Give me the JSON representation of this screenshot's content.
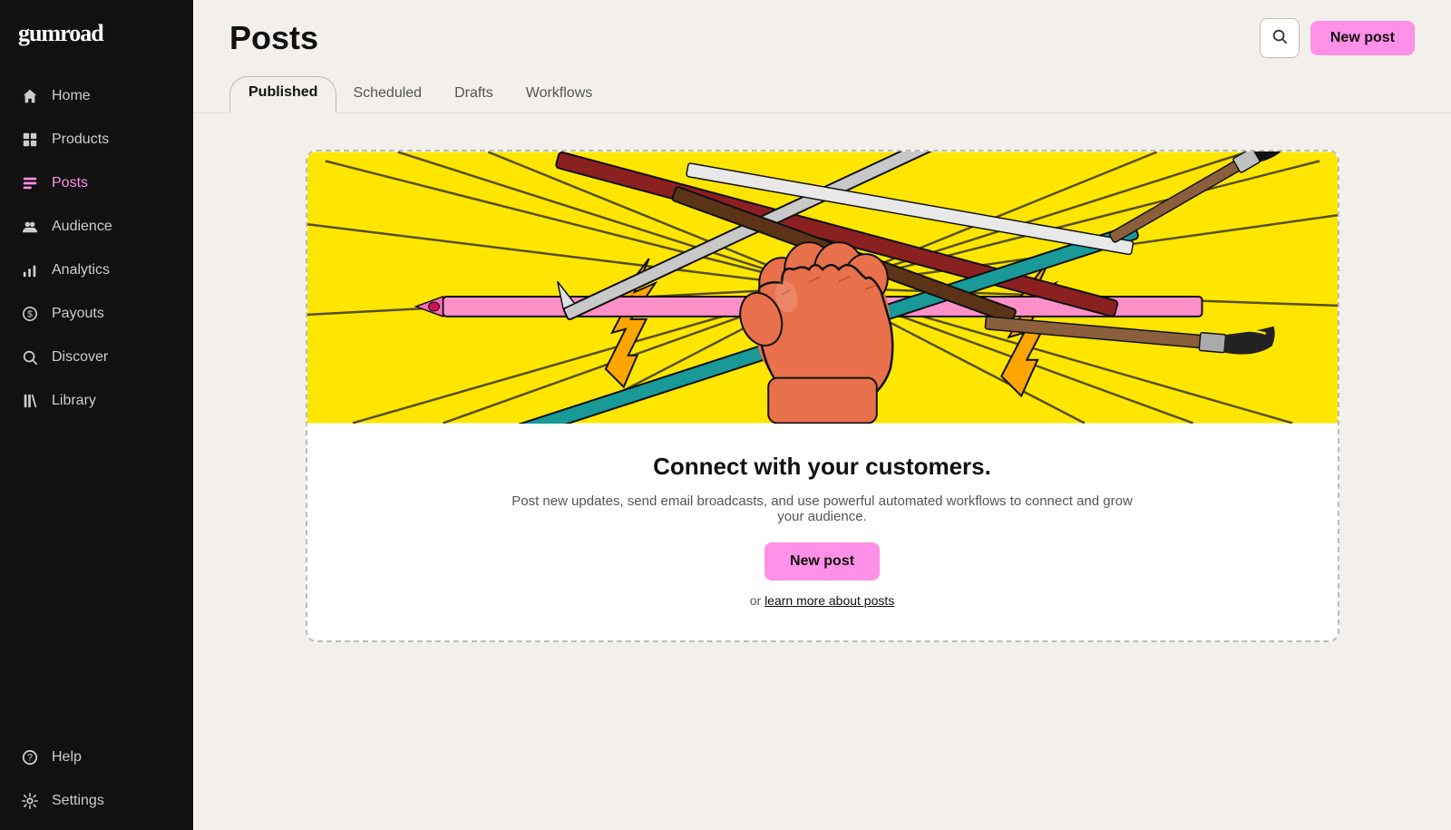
{
  "sidebar": {
    "logo": "gumroad",
    "items": [
      {
        "id": "home",
        "label": "Home",
        "icon": "home-icon"
      },
      {
        "id": "products",
        "label": "Products",
        "icon": "products-icon"
      },
      {
        "id": "posts",
        "label": "Posts",
        "icon": "posts-icon",
        "active": true
      },
      {
        "id": "audience",
        "label": "Audience",
        "icon": "audience-icon"
      },
      {
        "id": "analytics",
        "label": "Analytics",
        "icon": "analytics-icon"
      },
      {
        "id": "payouts",
        "label": "Payouts",
        "icon": "payouts-icon"
      },
      {
        "id": "discover",
        "label": "Discover",
        "icon": "discover-icon"
      },
      {
        "id": "library",
        "label": "Library",
        "icon": "library-icon"
      }
    ],
    "bottom_items": [
      {
        "id": "help",
        "label": "Help",
        "icon": "help-icon"
      },
      {
        "id": "settings",
        "label": "Settings",
        "icon": "settings-icon"
      }
    ]
  },
  "header": {
    "title": "Posts",
    "new_post_label": "New post",
    "tabs": [
      {
        "id": "published",
        "label": "Published",
        "active": true
      },
      {
        "id": "scheduled",
        "label": "Scheduled",
        "active": false
      },
      {
        "id": "drafts",
        "label": "Drafts",
        "active": false
      },
      {
        "id": "workflows",
        "label": "Workflows",
        "active": false
      }
    ]
  },
  "empty_state": {
    "title": "Connect with your customers.",
    "description": "Post new updates, send email broadcasts, and use powerful automated workflows to connect and grow your audience.",
    "new_post_label": "New post",
    "learn_more_prefix": "or ",
    "learn_more_label": "learn more about posts"
  }
}
